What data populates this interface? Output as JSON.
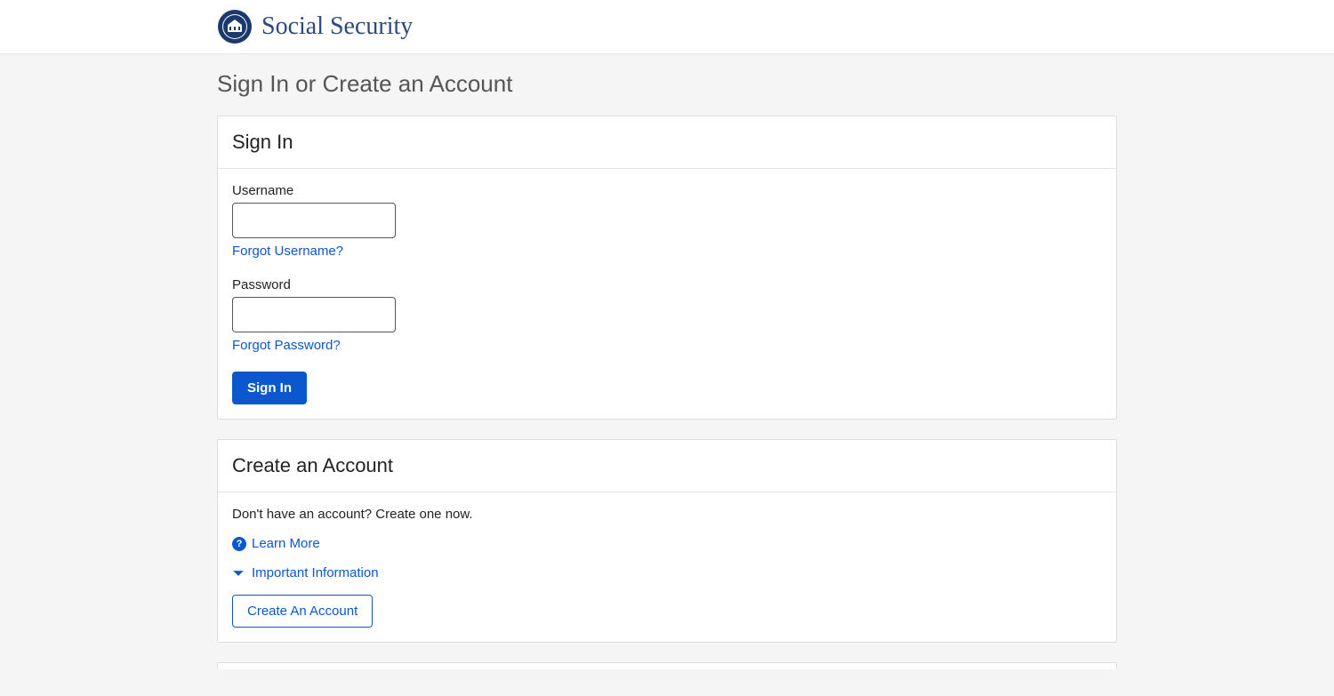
{
  "header": {
    "site_title": "Social Security"
  },
  "page": {
    "title": "Sign In or Create an Account"
  },
  "signin": {
    "heading": "Sign In",
    "username_label": "Username",
    "forgot_username": "Forgot Username?",
    "password_label": "Password",
    "forgot_password": "Forgot Password?",
    "button": "Sign In"
  },
  "create": {
    "heading": "Create an Account",
    "prompt": "Don't have an account? Create one now.",
    "learn_more": "Learn More",
    "important_info": "Important Information",
    "button": "Create An Account"
  }
}
